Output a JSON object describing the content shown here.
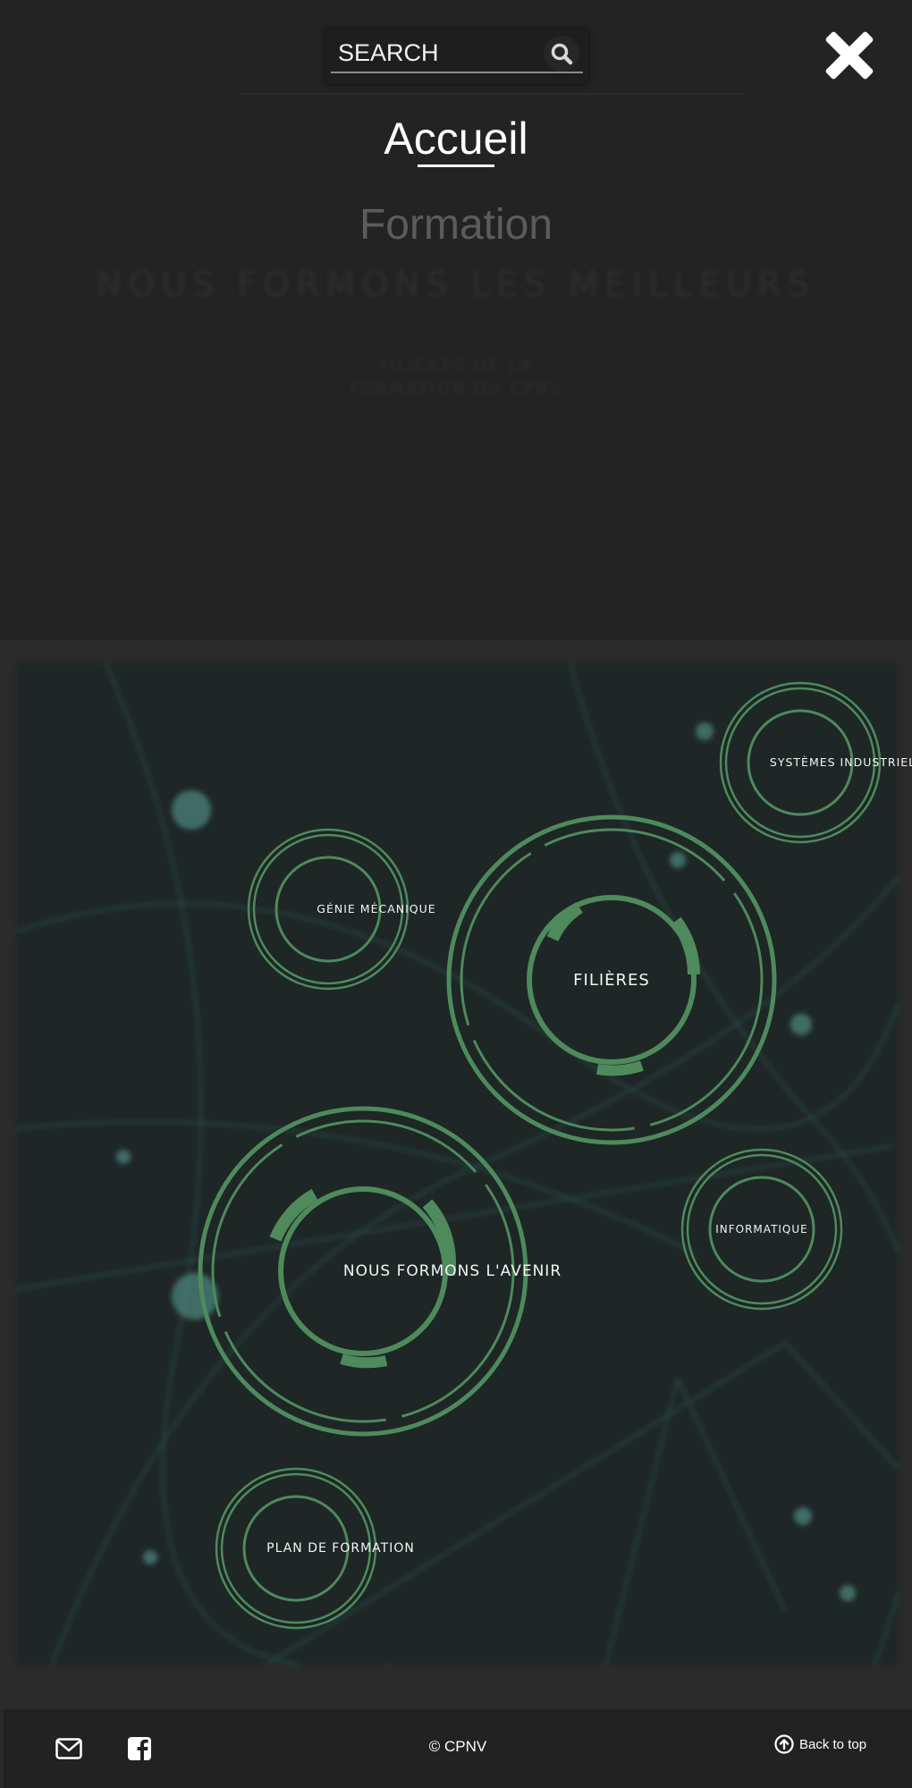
{
  "search": {
    "placeholder": "SEARCH"
  },
  "menu": {
    "items": [
      "Accueil",
      "Formation"
    ]
  },
  "background": {
    "title": "NOUS FORMONS LES MEILLEURS",
    "subtitle_line1": "FILIÈRES DE LA",
    "subtitle_line2": "FORMATION DU CPNV"
  },
  "nodes": {
    "systemes": "SYSTÈMES INDUSTRIELS",
    "genie": "GÉNIE MÉCANIQUE",
    "filieres": "FILIÈRES",
    "nous_formons": "NOUS FORMONS L'AVENIR",
    "informatique": "INFORMATIQUE",
    "plan": "PLAN DE FORMATION"
  },
  "footer": {
    "copyright": "© CPNV",
    "back_to_top": "Back to top"
  },
  "icons": {
    "search": "search-icon",
    "close": "close-icon",
    "mail": "mail-icon",
    "facebook": "facebook-icon",
    "back_top": "arrow-up-circle-icon"
  },
  "colors": {
    "ring": "#4e8a5c",
    "ring_light": "#6aa672",
    "overlay": "#232323",
    "footer": "#222222"
  }
}
